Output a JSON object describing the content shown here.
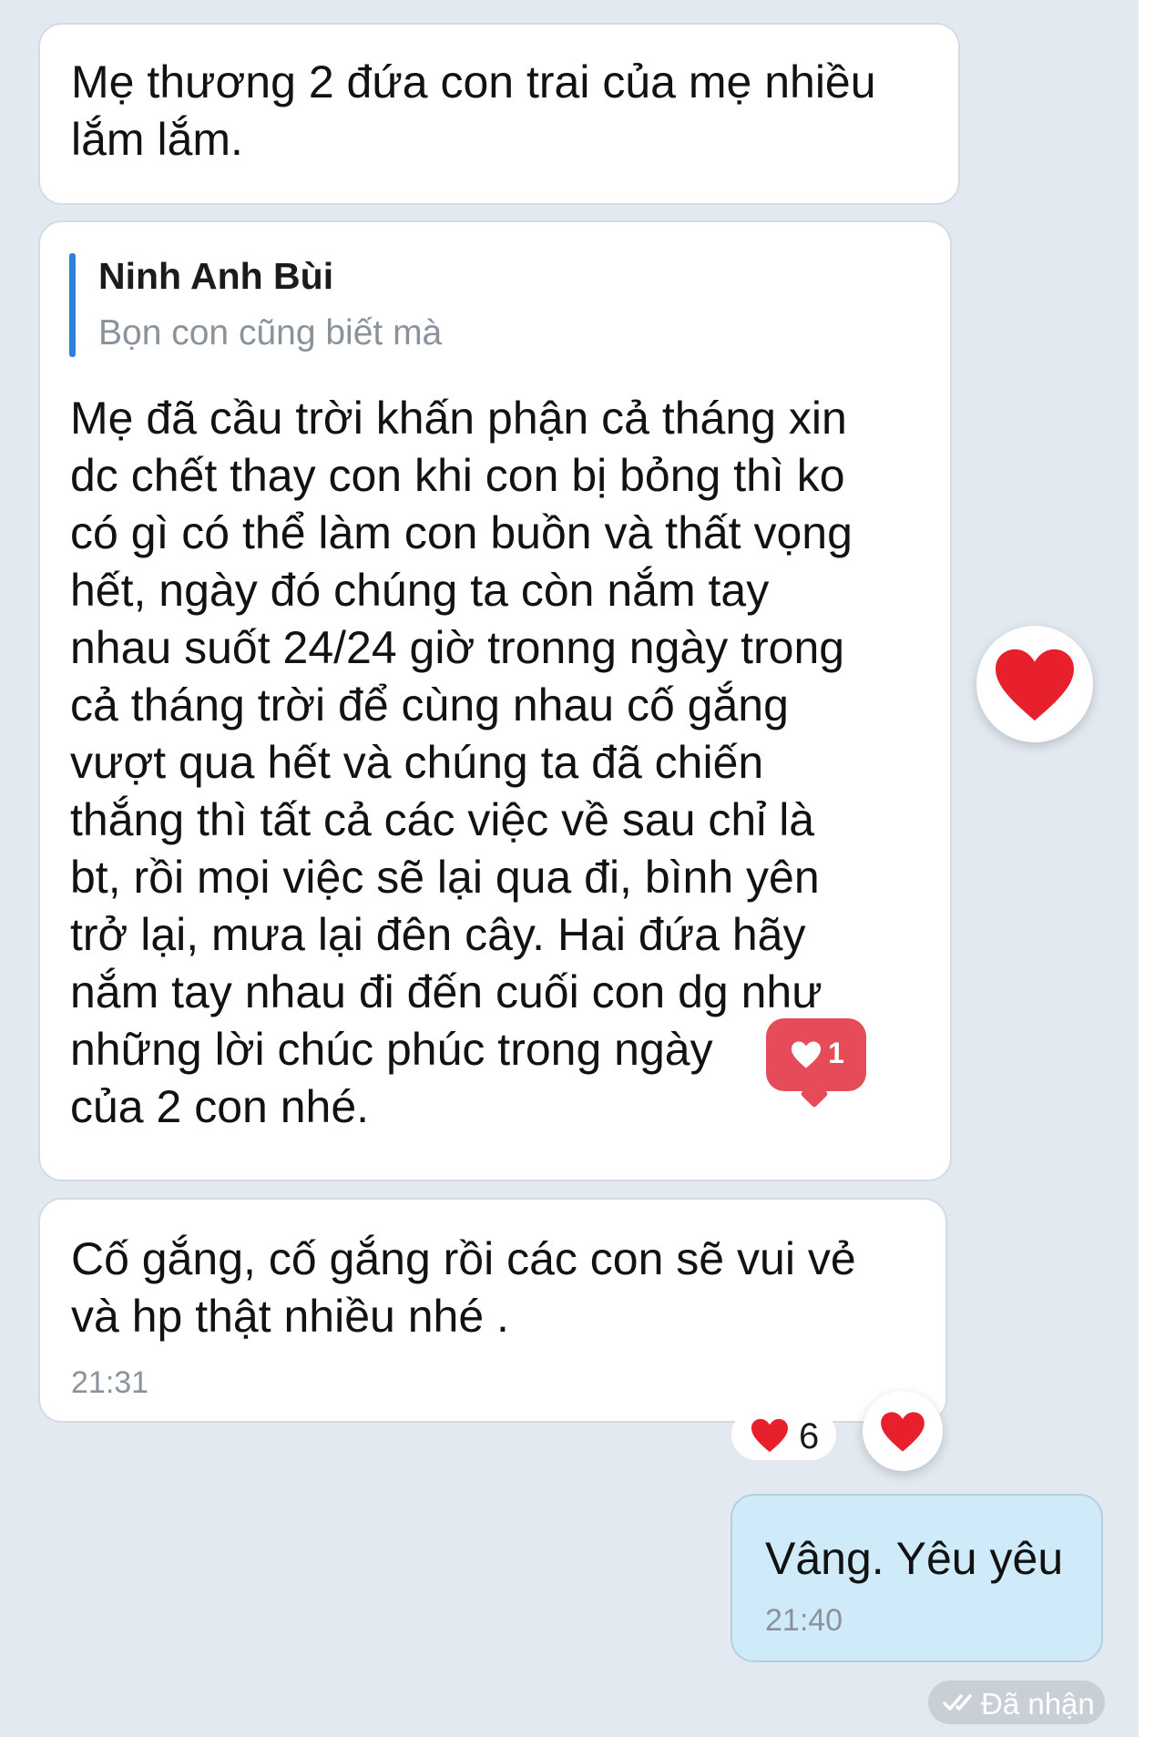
{
  "messages": [
    {
      "text": "Mẹ thương 2 đứa con trai của mẹ nhiều\nlắm lắm."
    },
    {
      "reply_to": {
        "name": "Ninh Anh Bùi",
        "text": "Bọn con cũng biết mà"
      },
      "text": "Mẹ đã cầu trời khấn phận cả tháng xin\ndc chết thay con khi con bị bỏng thì ko\ncó gì có thể làm con buồn và thất vọng\nhết, ngày đó chúng ta còn nắm tay\nnhau suốt 24/24 giờ tronng ngày trong\ncả tháng trời để cùng nhau cố gắng\nvượt qua hết và chúng ta đã chiến\nthắng thì tất cả các việc về sau chỉ là\nbt, rồi mọi việc sẽ lại qua đi, bình yên\ntrở lại, mưa lại đên cây. Hai đứa hãy\nnắm tay nhau đi đến cuối con dg như\nnhững lời chúc phúc trong ngày\ncủa 2 con nhé.",
      "reaction_count": "1"
    },
    {
      "text": "Cố gắng, cố gắng rồi các con sẽ vui vẻ\nvà hp thật nhiều nhé .",
      "time": "21:31",
      "reaction_count": "6"
    }
  ],
  "sent_message": {
    "text": "Vâng. Yêu yêu",
    "time": "21:40",
    "status": "Đã nhận"
  },
  "colors": {
    "heart": "#e8202e",
    "badge": "#e64b59",
    "sent_bubble": "#cfeaf8",
    "background": "#e2e9f1"
  },
  "icons": [
    "heart-icon",
    "double-check-icon"
  ]
}
